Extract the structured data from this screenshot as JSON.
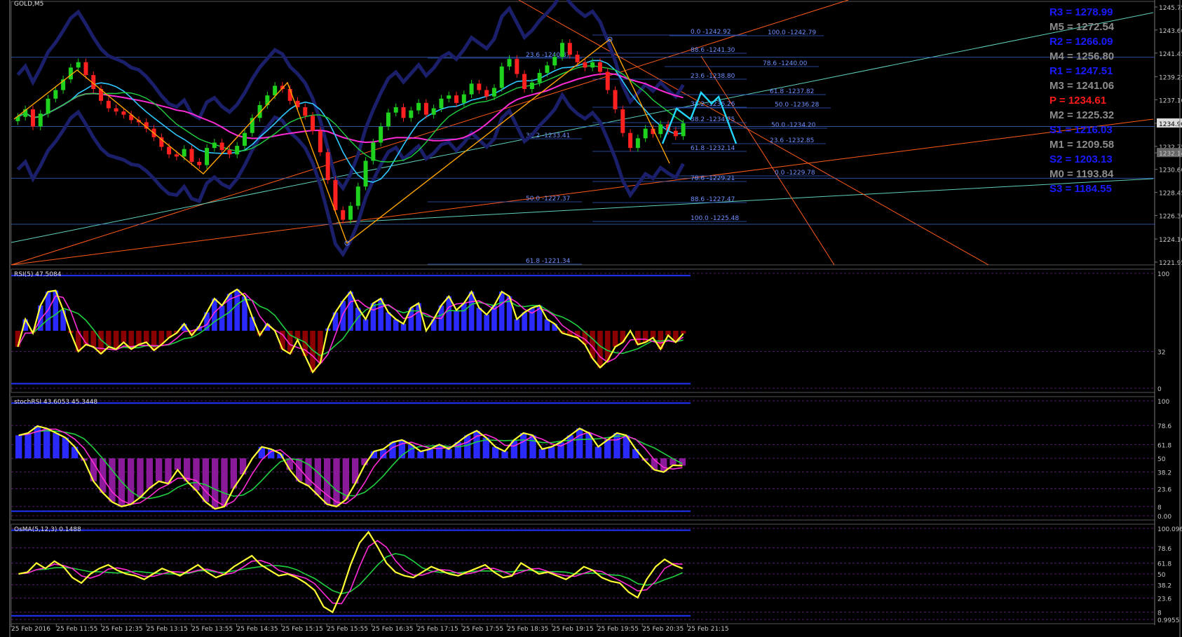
{
  "symbol": "GOLD,M5",
  "current_price": "1234.90",
  "panels": {
    "rsi_label": "RSI(5) 47.5084",
    "stoch_label": "stochRSI 43.6053 45.3448",
    "osma_label": "OsMA(5,12,3) 0.1488"
  },
  "pivot_levels": [
    {
      "label": "R3 = 1278.99",
      "color": "#1a1aff"
    },
    {
      "label": "M5 = 1272.54",
      "color": "#8c8c8c"
    },
    {
      "label": "R2 = 1266.09",
      "color": "#1a1aff"
    },
    {
      "label": "M4 = 1256.80",
      "color": "#8c8c8c"
    },
    {
      "label": "R1 = 1247.51",
      "color": "#1a1aff"
    },
    {
      "label": "M3 = 1241.06",
      "color": "#8c8c8c"
    },
    {
      "label": "P  = 1234.61",
      "color": "#ff1a1a"
    },
    {
      "label": "M2 = 1225.32",
      "color": "#8c8c8c"
    },
    {
      "label": "S1 = 1216.03",
      "color": "#1a1aff"
    },
    {
      "label": "M1 = 1209.58",
      "color": "#8c8c8c"
    },
    {
      "label": "S2 = 1203.13",
      "color": "#1a1aff"
    },
    {
      "label": "M0 = 1193.84",
      "color": "#8c8c8c"
    },
    {
      "label": "S3 = 1184.55",
      "color": "#1a1aff"
    }
  ],
  "fib_labels": [
    "0.0 -1242.92",
    "100.0 -1242.79",
    "88.6 -1241.30",
    "23.6 -1240.87",
    "78.6 -1240.00",
    "23.6 -1238.80",
    "61.8 -1237.82",
    "38.2 -1236.26",
    "50.0 -1236.28",
    "38.2 -1234.75",
    "50.0 -1234.20",
    "38.2 -1233.41",
    "23.6 -1232.85",
    "61.8 -1232.14",
    "0.0 -1229.78",
    "78.6 -1229.21",
    "50.0 -1227.37",
    "88.6 -1227.47",
    "100.0 -1225.48",
    "61.8 -1221.34"
  ],
  "chart_data": [
    {
      "type": "candlestick",
      "title": "GOLD,M5",
      "y_ticks": [
        "1245.75",
        "1243.60",
        "1241.45",
        "1239.25",
        "1237.10",
        "1234.90",
        "1232.75",
        "1232.14",
        "1230.60",
        "1228.45",
        "1226.30",
        "1224.10",
        "1221.95"
      ],
      "ylim": [
        1221.95,
        1245.75
      ],
      "x_ticks": [
        "25 Feb 2016",
        "25 Feb 11:55",
        "25 Feb 12:35",
        "25 Feb 13:15",
        "25 Feb 13:55",
        "25 Feb 14:35",
        "25 Feb 15:15",
        "25 Feb 15:55",
        "25 Feb 16:35",
        "25 Feb 17:15",
        "25 Feb 17:55",
        "25 Feb 18:35",
        "25 Feb 19:15",
        "25 Feb 19:55",
        "25 Feb 20:35",
        "25 Feb 21:15"
      ],
      "close": [
        1235.5,
        1236.2,
        1234.6,
        1235.8,
        1237.2,
        1238.0,
        1239.0,
        1240.1,
        1240.6,
        1239.4,
        1238.1,
        1237.0,
        1236.3,
        1236.0,
        1235.7,
        1235.2,
        1235.0,
        1234.4,
        1233.6,
        1232.7,
        1232.0,
        1231.8,
        1232.5,
        1231.3,
        1231.0,
        1232.6,
        1233.1,
        1232.4,
        1232.0,
        1232.8,
        1234.0,
        1235.4,
        1236.6,
        1237.5,
        1238.4,
        1238.1,
        1237.0,
        1236.4,
        1235.6,
        1234.2,
        1232.2,
        1229.6,
        1226.8,
        1225.9,
        1227.2,
        1229.0,
        1231.4,
        1233.1,
        1234.6,
        1235.9,
        1236.4,
        1235.4,
        1236.1,
        1236.8,
        1235.7,
        1236.3,
        1237.2,
        1237.5,
        1236.8,
        1237.6,
        1238.6,
        1238.0,
        1237.4,
        1238.2,
        1240.2,
        1240.9,
        1239.5,
        1238.1,
        1238.7,
        1239.6,
        1240.3,
        1241.1,
        1242.4,
        1241.3,
        1240.6,
        1240.1,
        1240.6,
        1239.7,
        1238.0,
        1236.2,
        1234.0,
        1232.6,
        1233.5,
        1234.4,
        1233.9,
        1234.8,
        1234.2,
        1233.7,
        1234.9
      ],
      "markers": {
        "swing_high": "1242.92",
        "swing_low": "1225.48"
      }
    },
    {
      "type": "line",
      "title": "RSI(5) 47.5084",
      "y_ticks": [
        "100",
        "32",
        "0"
      ],
      "ylim": [
        0,
        100
      ],
      "series": [
        {
          "name": "RSI",
          "values": [
            36,
            60,
            48,
            72,
            84,
            85,
            68,
            48,
            32,
            38,
            36,
            30,
            36,
            34,
            40,
            34,
            38,
            40,
            33,
            38,
            44,
            48,
            56,
            46,
            54,
            66,
            78,
            72,
            82,
            86,
            80,
            62,
            46,
            56,
            50,
            34,
            30,
            42,
            28,
            14,
            22,
            52,
            66,
            76,
            84,
            70,
            60,
            74,
            78,
            66,
            60,
            56,
            70,
            74,
            50,
            60,
            72,
            80,
            68,
            74,
            84,
            70,
            64,
            72,
            84,
            80,
            60,
            66,
            70,
            72,
            60,
            56,
            48,
            46,
            44,
            38,
            26,
            18,
            24,
            36,
            40,
            50,
            38,
            40,
            44,
            34,
            46,
            40,
            47.5
          ]
        }
      ]
    },
    {
      "type": "line",
      "title": "stochRSI 43.6053 45.3448",
      "y_ticks": [
        "100",
        "78.6",
        "61.8",
        "50",
        "38.2",
        "23.6",
        "8",
        "0.00"
      ],
      "ylim": [
        0,
        100
      ],
      "series": [
        {
          "name": "stochRSI",
          "values": [
            70,
            72,
            78,
            76,
            72,
            68,
            60,
            48,
            30,
            20,
            12,
            8,
            10,
            16,
            24,
            30,
            28,
            40,
            30,
            22,
            12,
            6,
            8,
            24,
            36,
            50,
            60,
            58,
            54,
            40,
            30,
            26,
            18,
            10,
            8,
            14,
            28,
            44,
            56,
            58,
            64,
            66,
            62,
            56,
            58,
            62,
            58,
            64,
            70,
            74,
            68,
            60,
            56,
            66,
            72,
            70,
            58,
            60,
            64,
            70,
            76,
            72,
            60,
            66,
            72,
            70,
            58,
            48,
            40,
            38,
            44,
            43.6
          ]
        }
      ]
    },
    {
      "type": "line",
      "title": "OsMA(5,12,3) 0.1488",
      "y_ticks": [
        "100.0969",
        "78.6",
        "61.8",
        "50",
        "38.2",
        "23.6",
        "8",
        "0.9955"
      ],
      "ylim": [
        0,
        100
      ],
      "series": [
        {
          "name": "OsMA",
          "values": [
            50,
            52,
            62,
            56,
            64,
            58,
            46,
            40,
            50,
            56,
            60,
            54,
            50,
            48,
            44,
            50,
            56,
            52,
            48,
            54,
            60,
            52,
            46,
            50,
            58,
            64,
            70,
            60,
            54,
            48,
            50,
            46,
            40,
            32,
            14,
            8,
            30,
            60,
            84,
            96,
            80,
            62,
            52,
            48,
            46,
            52,
            58,
            54,
            50,
            48,
            52,
            56,
            60,
            52,
            46,
            48,
            62,
            56,
            50,
            52,
            48,
            44,
            50,
            58,
            54,
            46,
            42,
            40,
            30,
            24,
            44,
            58,
            66,
            60,
            56
          ]
        }
      ]
    }
  ]
}
